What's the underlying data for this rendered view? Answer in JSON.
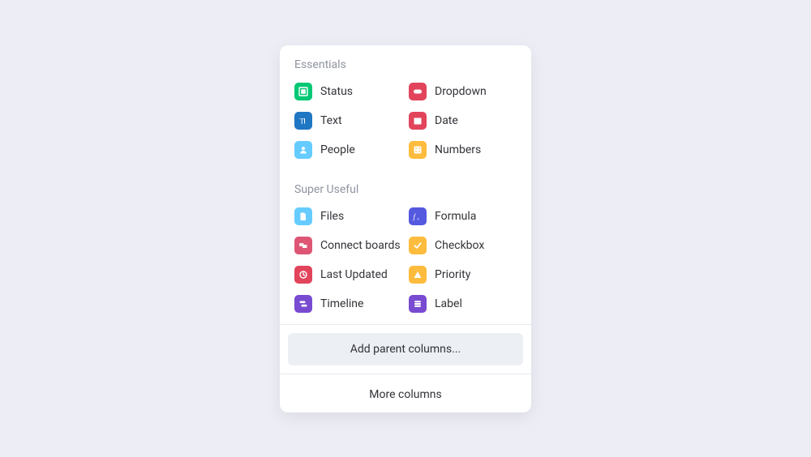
{
  "sections": [
    {
      "title": "Essentials",
      "items": [
        {
          "label": "Status",
          "icon": "status",
          "color": "#00c875"
        },
        {
          "label": "Dropdown",
          "icon": "dropdown",
          "color": "#e2445c"
        },
        {
          "label": "Text",
          "icon": "text",
          "color": "#1f76c2"
        },
        {
          "label": "Date",
          "icon": "date",
          "color": "#e2445c"
        },
        {
          "label": "People",
          "icon": "people",
          "color": "#66ccff"
        },
        {
          "label": "Numbers",
          "icon": "numbers",
          "color": "#fdbc3d"
        }
      ]
    },
    {
      "title": "Super Useful",
      "items": [
        {
          "label": "Files",
          "icon": "files",
          "color": "#66ccff"
        },
        {
          "label": "Formula",
          "icon": "formula",
          "color": "#5559df"
        },
        {
          "label": "Connect boards",
          "icon": "connect",
          "color": "#de5674"
        },
        {
          "label": "Checkbox",
          "icon": "checkbox",
          "color": "#fdbc3d"
        },
        {
          "label": "Last Updated",
          "icon": "updated",
          "color": "#e2445c"
        },
        {
          "label": "Priority",
          "icon": "priority",
          "color": "#fdbc3d"
        },
        {
          "label": "Timeline",
          "icon": "timeline",
          "color": "#784bd1"
        },
        {
          "label": "Label",
          "icon": "label",
          "color": "#784bd1"
        }
      ]
    }
  ],
  "footer": {
    "parent": "Add parent columns...",
    "more": "More columns"
  }
}
